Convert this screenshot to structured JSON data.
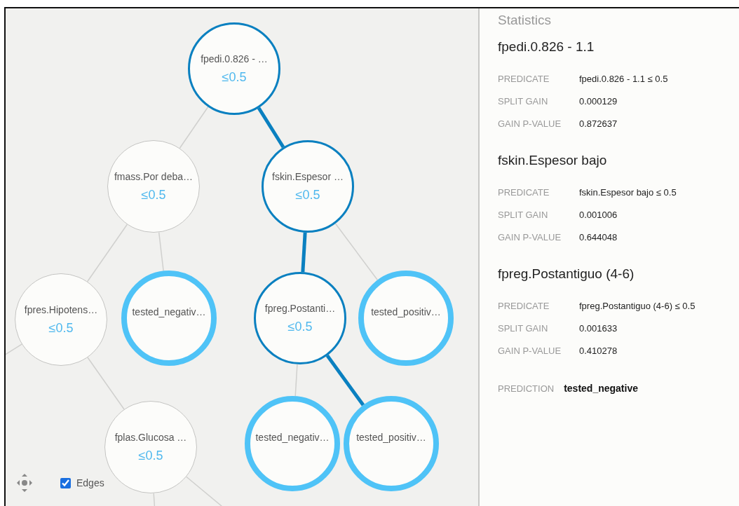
{
  "tree": {
    "label": "fpedi.0.826 - …",
    "threshold": "≤0.5",
    "kind": "split",
    "on_path": true,
    "children": [
      {
        "label": "fmass.Por deba…",
        "threshold": "≤0.5",
        "kind": "split",
        "on_path": false,
        "children": [
          {
            "label": "fpres.Hipotens…",
            "threshold": "≤0.5",
            "kind": "split",
            "on_path": false,
            "offscreen_branches": true,
            "children": [
              {
                "label": "fplas.Glucosa …",
                "threshold": "≤0.5",
                "kind": "split",
                "on_path": false,
                "offscreen_branches": true
              }
            ]
          },
          {
            "label": "tested_negativ…",
            "kind": "leaf",
            "on_path": false
          }
        ]
      },
      {
        "label": "fskin.Espesor …",
        "threshold": "≤0.5",
        "kind": "split",
        "on_path": true,
        "children": [
          {
            "label": "fpreg.Postanti…",
            "threshold": "≤0.5",
            "kind": "split",
            "on_path": true,
            "children": [
              {
                "label": "tested_negativ…",
                "kind": "leaf",
                "on_path": false
              },
              {
                "label": "tested_positiv…",
                "kind": "leaf",
                "on_path": true
              }
            ]
          },
          {
            "label": "tested_positiv…",
            "kind": "leaf",
            "on_path": false
          }
        ]
      }
    ]
  },
  "controls": {
    "edges": {
      "label": "Edges",
      "checked": true
    }
  },
  "statistics": {
    "title": "Statistics",
    "sections": [
      {
        "title": "fpedi.0.826 - 1.1",
        "rows": [
          {
            "label": "PREDICATE",
            "value": "fpedi.0.826 - 1.1 ≤ 0.5"
          },
          {
            "label": "SPLIT GAIN",
            "value": "0.000129"
          },
          {
            "label": "GAIN P-VALUE",
            "value": "0.872637"
          }
        ]
      },
      {
        "title": "fskin.Espesor bajo",
        "rows": [
          {
            "label": "PREDICATE",
            "value": "fskin.Espesor bajo ≤ 0.5"
          },
          {
            "label": "SPLIT GAIN",
            "value": "0.001006"
          },
          {
            "label": "GAIN P-VALUE",
            "value": "0.644048"
          }
        ]
      },
      {
        "title": "fpreg.Postantiguo (4-6)",
        "rows": [
          {
            "label": "PREDICATE",
            "value": "fpreg.Postantiguo (4-6) ≤ 0.5"
          },
          {
            "label": "SPLIT GAIN",
            "value": "0.001633"
          },
          {
            "label": "GAIN P-VALUE",
            "value": "0.410278"
          }
        ]
      }
    ],
    "prediction": {
      "label": "PREDICTION",
      "value": "tested_negative"
    }
  }
}
